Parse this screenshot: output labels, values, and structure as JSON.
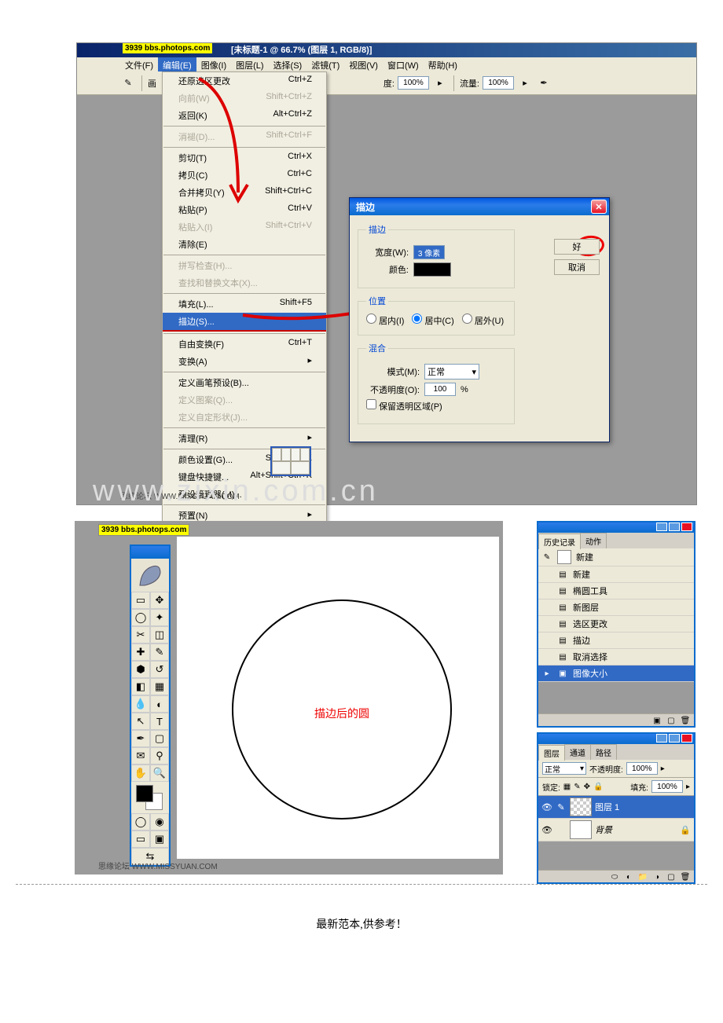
{
  "watermark_site": "3939 bbs.photops.com",
  "title_bar": "[未标题-1 @ 66.7% (图层 1, RGB/8)]",
  "menus": {
    "file": "文件(F)",
    "edit": "编辑(E)",
    "image": "图像(I)",
    "layer": "图层(L)",
    "select": "选择(S)",
    "filter": "滤镜(T)",
    "view": "视图(V)",
    "window": "窗口(W)",
    "help": "帮助(H)"
  },
  "toolbar": {
    "char_label": "画",
    "opacity_label": "度:",
    "opacity_val": "100%",
    "flow_label": "流量:",
    "flow_val": "100%"
  },
  "edit_menu": {
    "undo_sel": {
      "label": "还原选区更改",
      "shortcut": "Ctrl+Z"
    },
    "forward": {
      "label": "向前(W)",
      "shortcut": "Shift+Ctrl+Z"
    },
    "back": {
      "label": "返回(K)",
      "shortcut": "Alt+Ctrl+Z"
    },
    "fade": {
      "label": "消褪(D)...",
      "shortcut": "Shift+Ctrl+F"
    },
    "cut": {
      "label": "剪切(T)",
      "shortcut": "Ctrl+X"
    },
    "copy": {
      "label": "拷贝(C)",
      "shortcut": "Ctrl+C"
    },
    "copy_merged": {
      "label": "合并拷贝(Y)",
      "shortcut": "Shift+Ctrl+C"
    },
    "paste": {
      "label": "粘贴(P)",
      "shortcut": "Ctrl+V"
    },
    "paste_into": {
      "label": "粘贴入(I)",
      "shortcut": "Shift+Ctrl+V"
    },
    "clear": {
      "label": "清除(E)",
      "shortcut": ""
    },
    "spell": {
      "label": "拼写检查(H)...",
      "shortcut": ""
    },
    "find_replace": {
      "label": "查找和替换文本(X)...",
      "shortcut": ""
    },
    "fill": {
      "label": "填充(L)...",
      "shortcut": "Shift+F5"
    },
    "stroke": {
      "label": "描边(S)...",
      "shortcut": ""
    },
    "free_transform": {
      "label": "自由变换(F)",
      "shortcut": "Ctrl+T"
    },
    "transform": {
      "label": "变换(A)",
      "shortcut": ""
    },
    "define_brush": {
      "label": "定义画笔预设(B)...",
      "shortcut": ""
    },
    "define_pattern": {
      "label": "定义图案(Q)...",
      "shortcut": ""
    },
    "define_shape": {
      "label": "定义自定形状(J)...",
      "shortcut": ""
    },
    "purge": {
      "label": "清理(R)",
      "shortcut": ""
    },
    "color_settings": {
      "label": "颜色设置(G)...",
      "shortcut": "Shift+Ctrl+K"
    },
    "keyboard": {
      "label": "键盘快捷键...",
      "shortcut": "Alt+Shift+Ctrl+K"
    },
    "preset_mgr": {
      "label": "预设管理器(M)...",
      "shortcut": ""
    },
    "preferences": {
      "label": "预置(N)",
      "shortcut": ""
    }
  },
  "stroke_dialog": {
    "title": "描边",
    "group_stroke": "描边",
    "width_label": "宽度(W):",
    "width_val": "3 像素",
    "color_label": "颜色:",
    "group_position": "位置",
    "pos_inside": "居内(I)",
    "pos_center": "居中(C)",
    "pos_outside": "居外(U)",
    "group_blend": "混合",
    "mode_label": "模式(M):",
    "mode_val": "正常",
    "opacity_label": "不透明度(O):",
    "opacity_val": "100",
    "opacity_pct": "%",
    "preserve": "保留透明区域(P)",
    "ok": "好",
    "cancel": "取消"
  },
  "footer1": "思缘论坛  WWW.MISSYUAN.COM",
  "watermark": "www.zixin.com.cn",
  "section2": {
    "circle_label": "描边后的圆",
    "history_panel": {
      "tab1": "历史记录",
      "tab2": "动作",
      "root": "新建",
      "items": [
        "新建",
        "椭圆工具",
        "新图层",
        "选区更改",
        "描边",
        "取消选择",
        "图像大小"
      ]
    },
    "layers_panel": {
      "tab1": "图层",
      "tab2": "通道",
      "tab3": "路径",
      "mode": "正常",
      "opacity_label": "不透明度:",
      "opacity": "100%",
      "lock_label": "锁定:",
      "fill_label": "填充:",
      "fill": "100%",
      "layer1": "图层 1",
      "bg_layer": "背景"
    }
  },
  "bottom": "最新范本,供参考！"
}
